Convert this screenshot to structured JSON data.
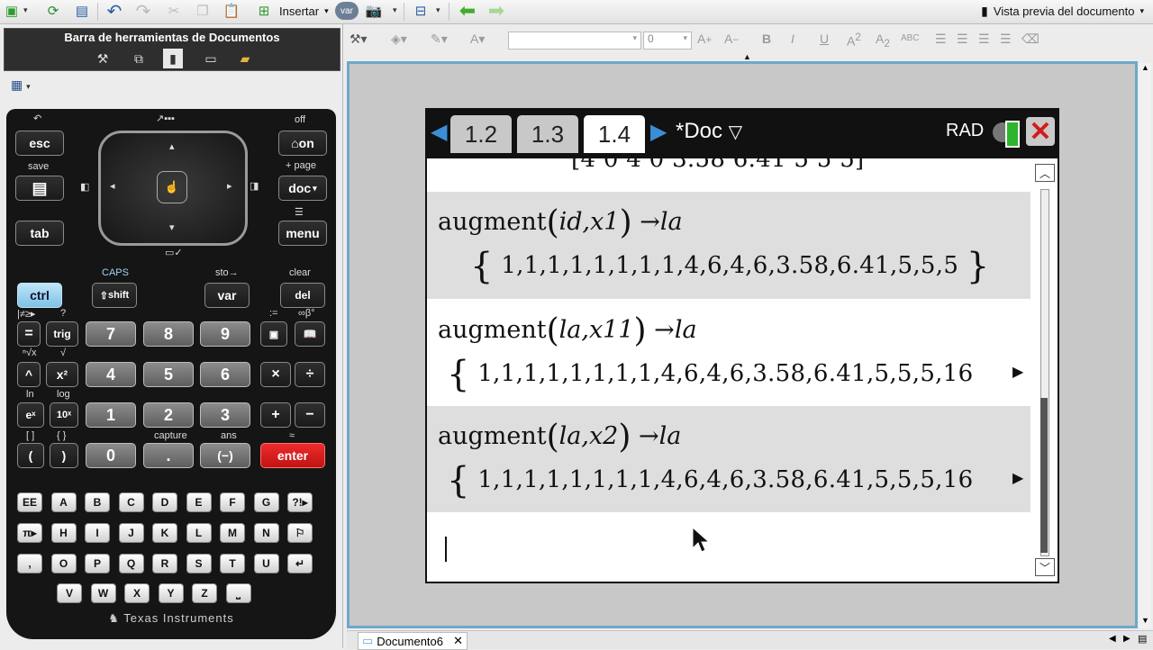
{
  "toolbar": {
    "insert_label": "Insertar",
    "var_label": "var",
    "preview_label": "Vista previa del documento"
  },
  "doc_toolbar": {
    "title": "Barra de herramientas de Documentos"
  },
  "format_bar": {
    "font_size": "0",
    "bold": "B",
    "italic": "I",
    "underline": "U",
    "superscript": "A",
    "subscript": "A",
    "caps": "ABC",
    "font_color": "A",
    "grow": "A",
    "shrink": "A"
  },
  "calculator": {
    "nav_labels": {
      "off": "off",
      "save": "save",
      "page": "+ page"
    },
    "keys": {
      "esc": "esc",
      "on": "on",
      "doc": "doc",
      "tab": "tab",
      "menu": "menu",
      "ctrl": "ctrl",
      "shift": "shift",
      "var": "var",
      "del": "del",
      "equals": "=",
      "trig": "trig",
      "n7": "7",
      "n8": "8",
      "n9": "9",
      "n4": "4",
      "n5": "5",
      "n6": "6",
      "n1": "1",
      "n2": "2",
      "n3": "3",
      "n0": "0",
      "caret": "^",
      "x2": "x²",
      "ex": "eˣ",
      "tenx": "10ˣ",
      "lparen": "(",
      "rparen": ")",
      "dot": ".",
      "neg": "(−)",
      "enter": "enter",
      "times": "×",
      "divide": "÷",
      "plus": "+",
      "minus": "−"
    },
    "second_labels": {
      "caps": "CAPS",
      "sto": "sto→",
      "clear": "clear",
      "ln": "ln",
      "log": "log",
      "capture": "capture",
      "ans": "ans",
      "brackets": "[ ]",
      "braces": "{ }",
      "approx": "≈"
    },
    "letters": [
      "EE",
      "A",
      "B",
      "C",
      "D",
      "E",
      "F",
      "G",
      "?!▸",
      "π▸",
      "H",
      "I",
      "J",
      "K",
      "L",
      "M",
      "N",
      "⚐",
      ",",
      "O",
      "P",
      "Q",
      "R",
      "S",
      "T",
      "U",
      "↵",
      "V",
      "W",
      "X",
      "Y",
      "Z",
      "⎵"
    ],
    "brand": "Texas Instruments"
  },
  "handheld": {
    "tabs": [
      "1.2",
      "1.3",
      "1.4"
    ],
    "active_tab": "1.4",
    "doc_label": "*Doc",
    "angle_mode": "RAD",
    "partial_row": "[4   0   4   0   3.58   6.41   5   5   5]",
    "entries": [
      {
        "func": "augment",
        "args": "id,x1",
        "target": "la",
        "result": "1,1,1,1,1,1,1,1,4,6,4,6,3.58,6.41,5,5,5",
        "truncated": false
      },
      {
        "func": "augment",
        "args": "la,x11",
        "target": "la",
        "result": "1,1,1,1,1,1,1,1,4,6,4,6,3.58,6.41,5,5,5,16",
        "truncated": true
      },
      {
        "func": "augment",
        "args": "la,x2",
        "target": "la",
        "result": "1,1,1,1,1,1,1,1,4,6,4,6,3.58,6.41,5,5,5,16",
        "truncated": true
      }
    ]
  },
  "bottom": {
    "doc_tab": "Documento6"
  },
  "colors": {
    "accent_blue": "#6fa8c8",
    "enter_red": "#c01313",
    "ctrl_blue": "#7ec2e6"
  }
}
